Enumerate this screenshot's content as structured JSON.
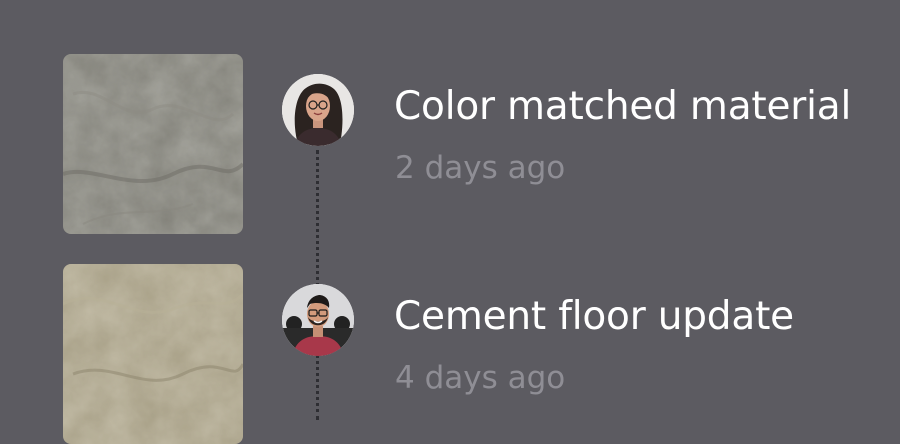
{
  "activity": [
    {
      "title": "Color matched material",
      "time": "2 days ago",
      "thumbnail": "material-texture",
      "thumbnail_colors": [
        "#807f76",
        "#6e6d66",
        "#918f86"
      ],
      "avatar": "user-avatar-woman"
    },
    {
      "title": "Cement floor update",
      "time": "4 days ago",
      "thumbnail": "material-texture",
      "thumbnail_colors": [
        "#a49b80",
        "#8f8770",
        "#b6ae95"
      ],
      "avatar": "user-avatar-man"
    }
  ],
  "colors": {
    "background": "#5c5b61",
    "title": "#ffffff",
    "timestamp": "#8f8e95",
    "connector": "#2e2e33"
  }
}
